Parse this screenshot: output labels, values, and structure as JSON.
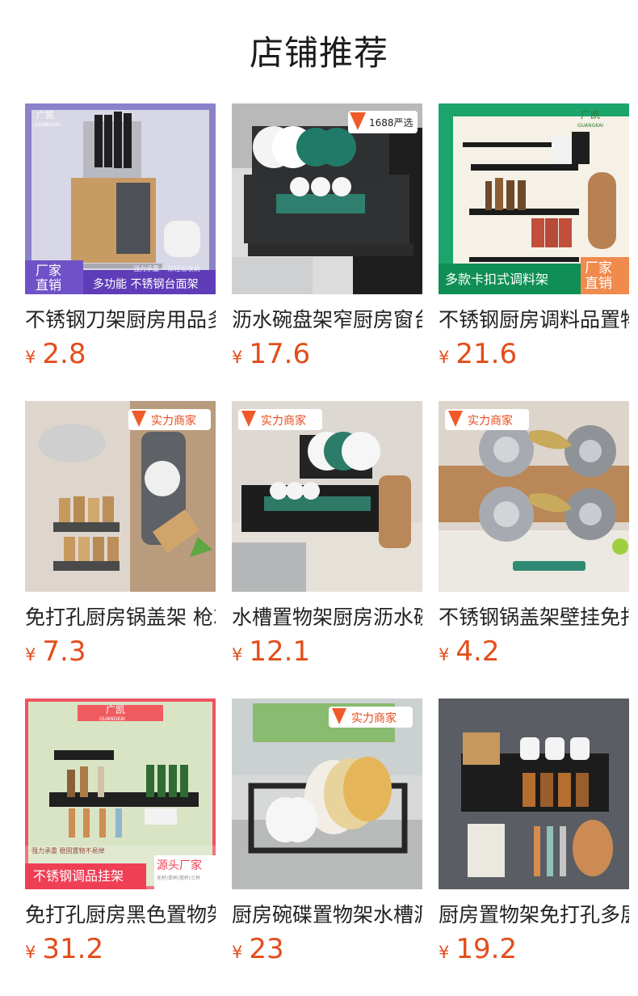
{
  "page": {
    "title": "店铺推荐",
    "currency_symbol": "¥"
  },
  "products": [
    {
      "name": "不锈钢刀架厨房用品多功能刀具收纳架",
      "price": "2.8",
      "badges": [
        "广凯",
        "GUANGKAI",
        "厂家",
        "直销",
        "多功能 不锈钢台面架",
        "强力承重 一架轻松收纳"
      ],
      "bg": "#6f68b8",
      "accent": "#d8d3f0"
    },
    {
      "name": "沥水碗盘架窄厨房窗台置物架",
      "price": "17.6",
      "badges": [
        "1688严选"
      ],
      "bg": "#d8d8d8",
      "accent": "#2f7b6b"
    },
    {
      "name": "不锈钢厨房调料品置物架",
      "price": "21.6",
      "badges": [
        "广凯",
        "GUANGKAI",
        "多款卡扣式调料架",
        "厂家",
        "直销"
      ],
      "bg": "#1fa36d",
      "accent": "#f2c46b"
    },
    {
      "name": "免打孔厨房锅盖架 枪灰色",
      "price": "7.3",
      "badges": [
        "实力商家"
      ],
      "bg": "#d9cfc4",
      "accent": "#b88952"
    },
    {
      "name": "水槽置物架厨房沥水碗架",
      "price": "12.1",
      "badges": [
        "实力商家"
      ],
      "bg": "#ddd9d2",
      "accent": "#2d6e60"
    },
    {
      "name": "不锈钢锅盖架壁挂免打孔",
      "price": "4.2",
      "badges": [
        "实力商家"
      ],
      "bg": "#d8d0c5",
      "accent": "#b7965b"
    },
    {
      "name": "免打孔厨房黑色置物架",
      "price": "31.2",
      "badges": [
        "广凯",
        "GUANGKAI",
        "强力承重 稳固置物不易掉",
        "源头厂家",
        "不锈钢调品挂架",
        "无杯/单杯/双杯/三杯"
      ],
      "bg": "#d7e3c3",
      "accent": "#f05b5f"
    },
    {
      "name": "厨房碗碟置物架水槽沥水架",
      "price": "23",
      "badges": [
        "实力商家"
      ],
      "bg": "#d4d6d7",
      "accent": "#e7c46c"
    },
    {
      "name": "厨房置物架免打孔多层收纳",
      "price": "19.2",
      "badges": [],
      "bg": "#5b5e63",
      "accent": "#c98a50"
    }
  ]
}
